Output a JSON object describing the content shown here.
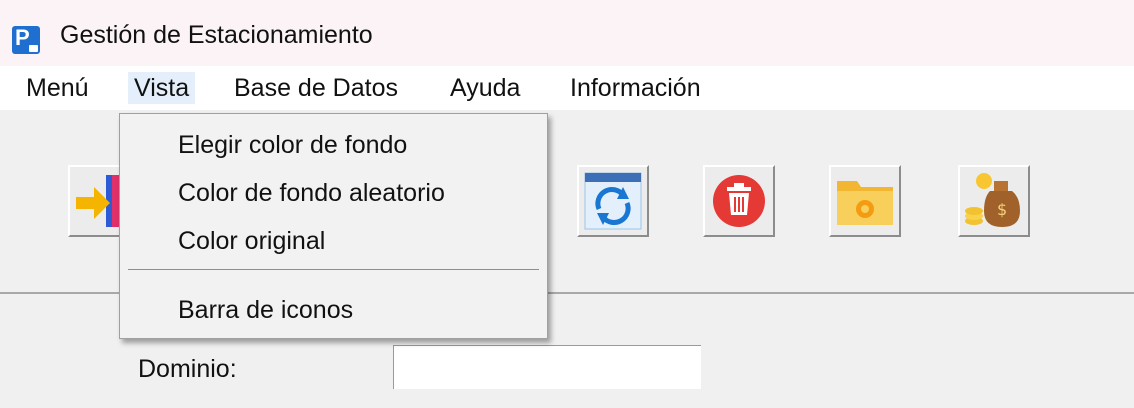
{
  "window": {
    "title": "Gestión de Estacionamiento"
  },
  "menubar": {
    "items": [
      "Menú",
      "Vista",
      "Base de Datos",
      "Ayuda",
      "Información"
    ],
    "active": "Vista"
  },
  "vista_menu": {
    "items": [
      "Elegir color de fondo",
      "Color de fondo aleatorio",
      "Color original",
      "Barra de iconos"
    ]
  },
  "toolbar": {
    "icons": [
      "entry-icon",
      "refresh-icon",
      "delete-icon",
      "folder-settings-icon",
      "money-bag-icon"
    ]
  },
  "form": {
    "dominio_label": "Dominio:",
    "dominio_value": ""
  },
  "colors": {
    "title_bg": "#fbf3f5",
    "menubar_bg": "#ffffff",
    "window_bg": "#f0f0f0",
    "app_icon": "#1f6fd1",
    "delete_red": "#e53935",
    "folder_yellow": "#f5c542"
  }
}
